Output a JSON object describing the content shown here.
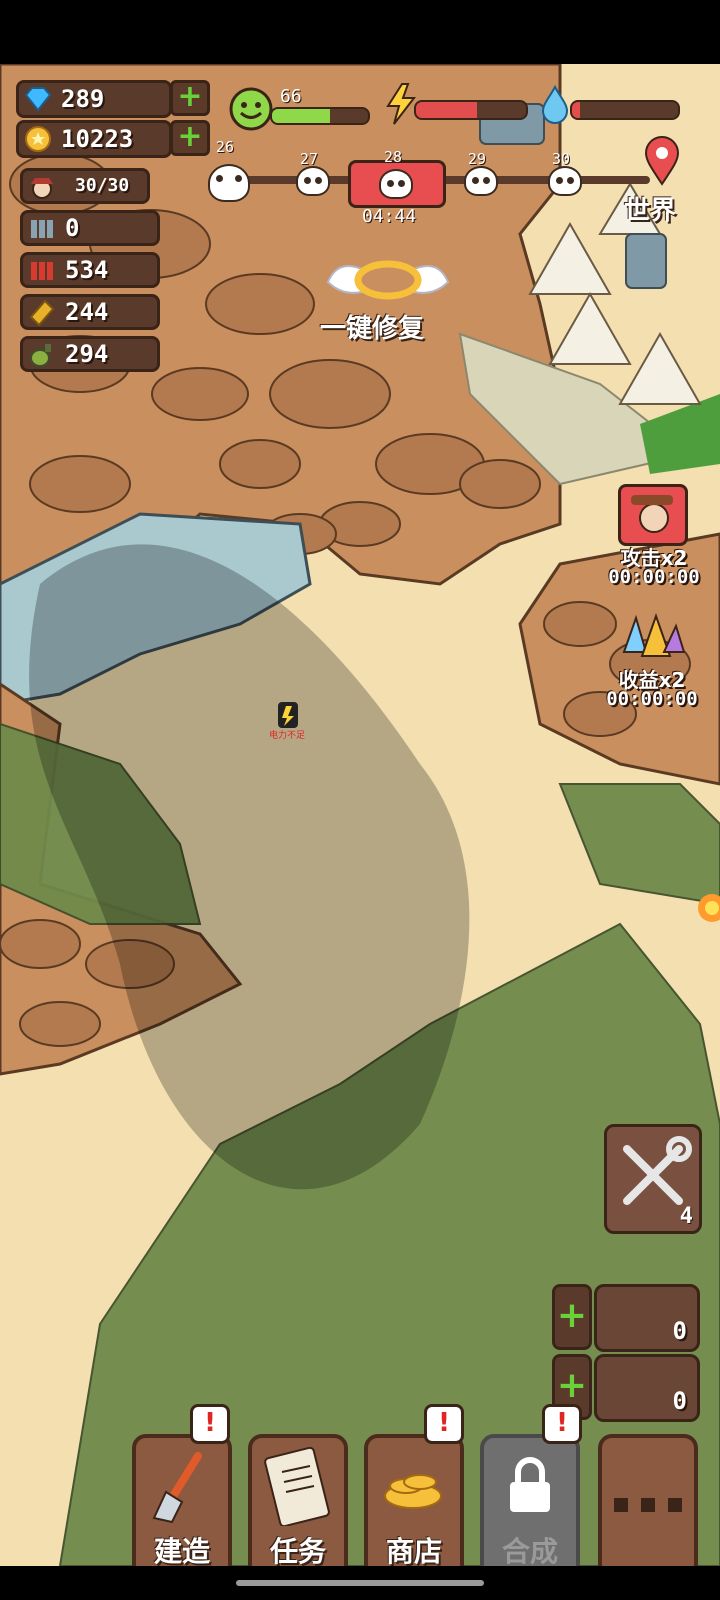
{
  "resources": {
    "gems": "289",
    "coins": "10223",
    "survivors": "30/30",
    "ammo_clip": "0",
    "shells": "534",
    "bullets": "244",
    "grenades": "294"
  },
  "status": {
    "happiness": "66",
    "power_fill": 0.55,
    "water_fill": 0.08
  },
  "waves": {
    "numbers": [
      "26",
      "27",
      "28",
      "29",
      "30"
    ],
    "timer": "04:44"
  },
  "world_button": {
    "label": "世界"
  },
  "repair_all": {
    "label": "一键修复"
  },
  "boosts": {
    "attack": {
      "label": "攻击x2",
      "timer": "00:00:00"
    },
    "income": {
      "label": "收益x2",
      "timer": "00:00:00"
    }
  },
  "tools": {
    "count": "4"
  },
  "slots": {
    "slot1": "0",
    "slot2": "0"
  },
  "map_markers": {
    "power_shortage": "电力不足"
  },
  "menu": {
    "build": "建造",
    "tasks": "任务",
    "shop": "商店",
    "craft": "合成"
  },
  "colors": {
    "sand": "#f3dfb0",
    "rock": "#c98f5e",
    "water": "#a9c9cf",
    "palm": "#6f8a4a",
    "panel_brown": "#5a3b2b",
    "accent_red": "#e24d4d",
    "plus_green": "#69d23a"
  }
}
